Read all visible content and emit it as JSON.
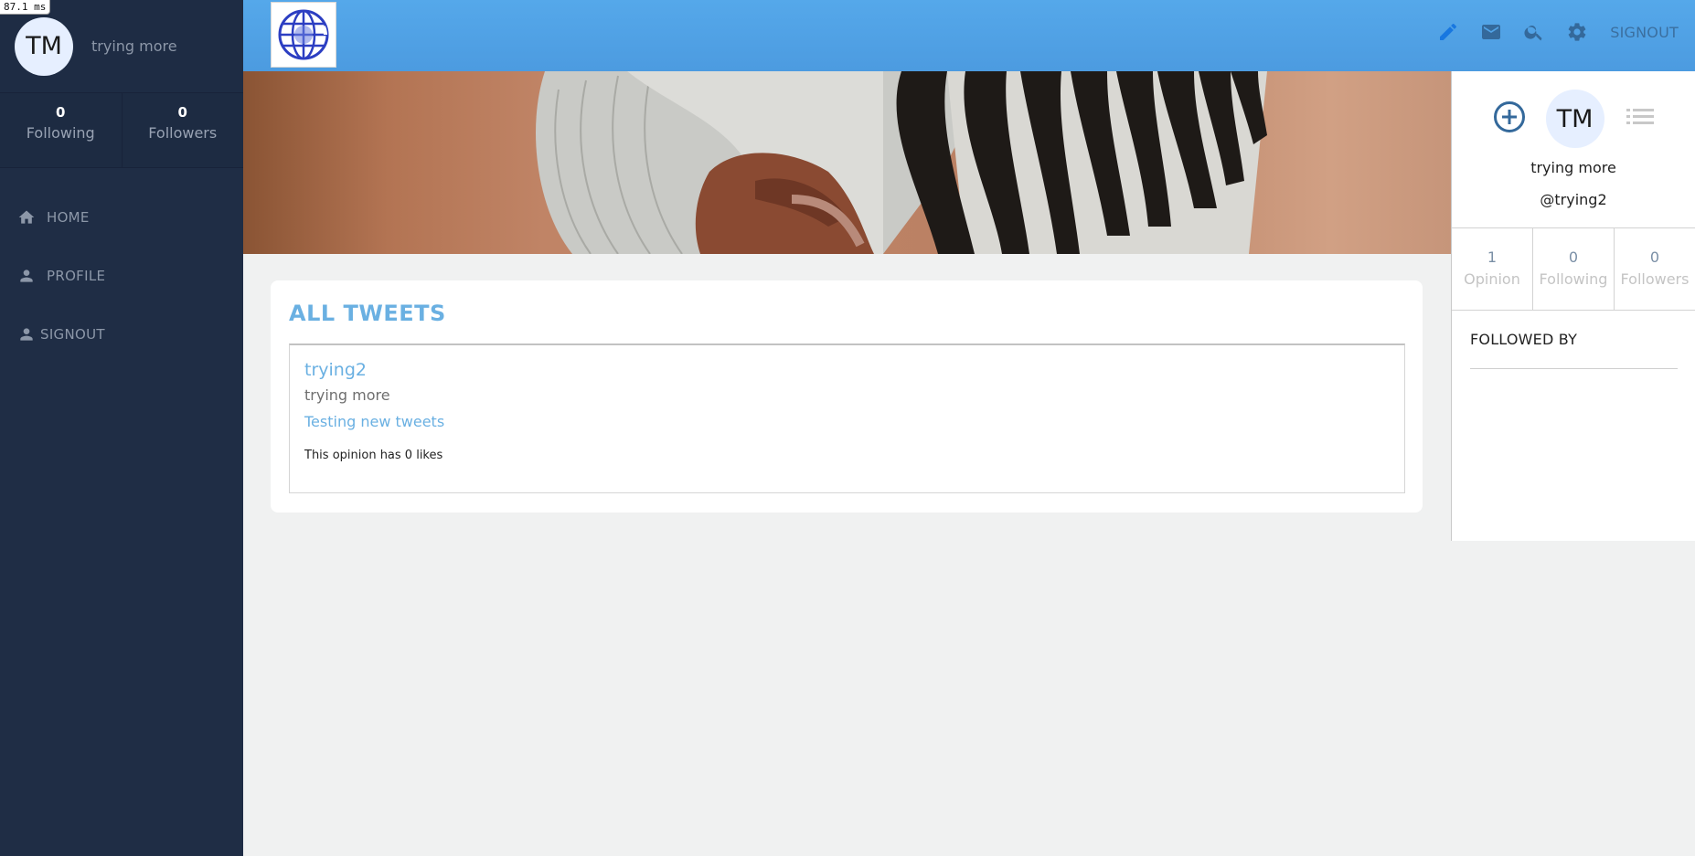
{
  "perf_badge": "87.1 ms",
  "user": {
    "initials": "TM",
    "display_name": "trying more",
    "handle": "@trying2"
  },
  "sidebar": {
    "stats": [
      {
        "value": "0",
        "label": "Following"
      },
      {
        "value": "0",
        "label": "Followers"
      }
    ],
    "nav": [
      {
        "label": "HOME",
        "icon": "home-icon"
      },
      {
        "label": "PROFILE",
        "icon": "person-icon"
      },
      {
        "label": "SIGNOUT",
        "icon": "person-icon"
      }
    ]
  },
  "topbar": {
    "logo": "globe-logo",
    "icons": [
      "pencil-icon",
      "mail-icon",
      "search-icon",
      "gear-icon"
    ],
    "signout_label": "SIGNOUT",
    "accent": "#4ea2e6"
  },
  "main": {
    "section_title": "ALL TWEETS",
    "tweets": [
      {
        "username": "trying2",
        "display_name": "trying more",
        "text": "Testing new tweets",
        "likes_text": "This opinion has 0 likes"
      }
    ]
  },
  "right_panel": {
    "icons": [
      "add-circle-icon",
      "list-icon"
    ],
    "stats": [
      {
        "value": "1",
        "label": "Opinion"
      },
      {
        "value": "0",
        "label": "Following"
      },
      {
        "value": "0",
        "label": "Followers"
      }
    ],
    "followed_by_title": "FOLLOWED BY"
  }
}
